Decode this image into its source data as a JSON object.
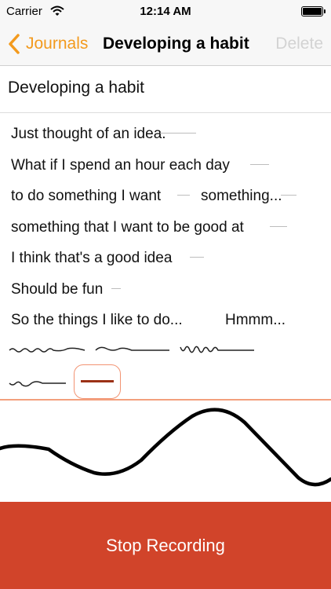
{
  "status_bar": {
    "carrier": "Carrier",
    "time": "12:14 AM",
    "wifi_icon": "wifi-icon",
    "battery_icon": "battery-icon"
  },
  "nav": {
    "back_label": "Journals",
    "title": "Developing a habit",
    "delete_label": "Delete"
  },
  "entry": {
    "title_value": "Developing a habit"
  },
  "transcript": {
    "lines": [
      "Just thought of an idea.",
      "What if I spend an hour each day",
      "to do something I want",
      "something that I want to be good at",
      "I think that's a good idea",
      "Should be fun",
      "So the things I like to do..."
    ],
    "line3_extra": "something...",
    "line7_extra": "Hmmm..."
  },
  "recording": {
    "stop_label": "Stop Recording"
  },
  "colors": {
    "accent": "#f39a1d",
    "stop_button": "#d1442a",
    "marker": "#f29372",
    "disabled": "#d3d3d3"
  }
}
